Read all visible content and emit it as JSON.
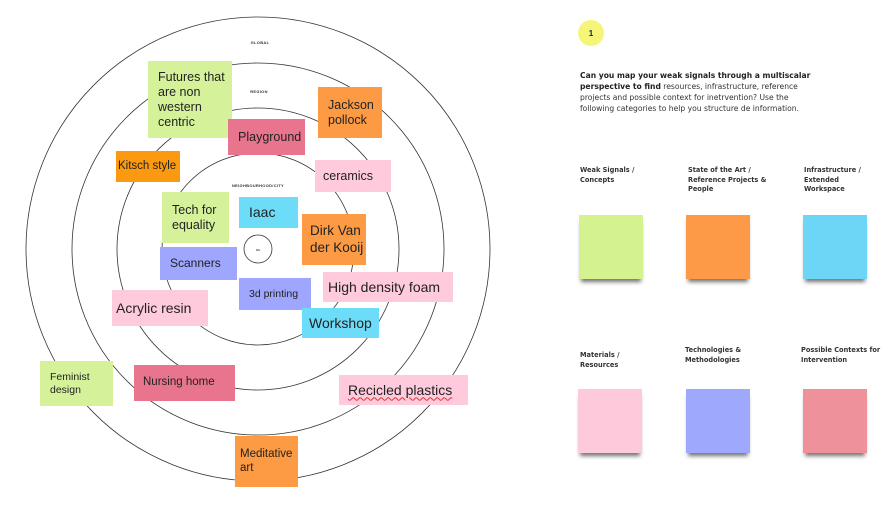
{
  "map": {
    "ring_labels": [
      "GLOBAL",
      "REGION",
      "NEIGHBOURHOOD/CITY"
    ],
    "center_label": "ME",
    "notes": [
      {
        "text": "Futures that are non western centric",
        "category": "weak-signals"
      },
      {
        "text": "Jackson pollock",
        "category": "state-of-the-art"
      },
      {
        "text": "Playground",
        "category": "possible-contexts"
      },
      {
        "text": "Kitsch style",
        "category": "state-of-the-art"
      },
      {
        "text": "ceramics",
        "category": "materials"
      },
      {
        "text": "Tech for equality",
        "category": "weak-signals"
      },
      {
        "text": "Iaac",
        "category": "infrastructure"
      },
      {
        "text": "Dirk Van der Kooij",
        "category": "state-of-the-art"
      },
      {
        "text": "Scanners",
        "category": "technologies"
      },
      {
        "text": "3d printing",
        "category": "technologies"
      },
      {
        "text": "High density foam",
        "category": "materials"
      },
      {
        "text": "Acrylic resin",
        "category": "materials"
      },
      {
        "text": "Workshop",
        "category": "infrastructure"
      },
      {
        "text": "Feminist design",
        "category": "weak-signals"
      },
      {
        "text": "Nursing home",
        "category": "possible-contexts"
      },
      {
        "text": "Recicled plastics",
        "category": "materials"
      },
      {
        "text": "Meditative art",
        "category": "state-of-the-art"
      }
    ]
  },
  "panel": {
    "step_number": "1",
    "question_bold": "Can you map your weak signals through a multiscalar perspective to find",
    "question_rest": " resources, infrastructure, reference projects and possible context for inetrvention? Use the following categories to help you structure de information.",
    "categories": [
      {
        "label": "Weak Signals / Concepts",
        "color": "#d5f291"
      },
      {
        "label": "State of the Art / Reference Projects & People",
        "color": "#fd9a48"
      },
      {
        "label": "Infrastructure / Extended Workspace",
        "color": "#6dd6f7"
      },
      {
        "label": "Materials / Resources",
        "color": "#ffc9dc"
      },
      {
        "label": "Technologies & Methodologies",
        "color": "#9ea8fd"
      },
      {
        "label": "Possible Contexts for Intervention",
        "color": "#ef919b"
      }
    ]
  },
  "colors": {
    "weak-signals": "#d5f29a",
    "state-of-the-art": "#fd9b45",
    "kitsch": "#fb9a10",
    "infrastructure": "#6ddcf8",
    "materials": "#ffcbdc",
    "technologies": "#9ea6fd",
    "possible-contexts": "#e8748d"
  }
}
